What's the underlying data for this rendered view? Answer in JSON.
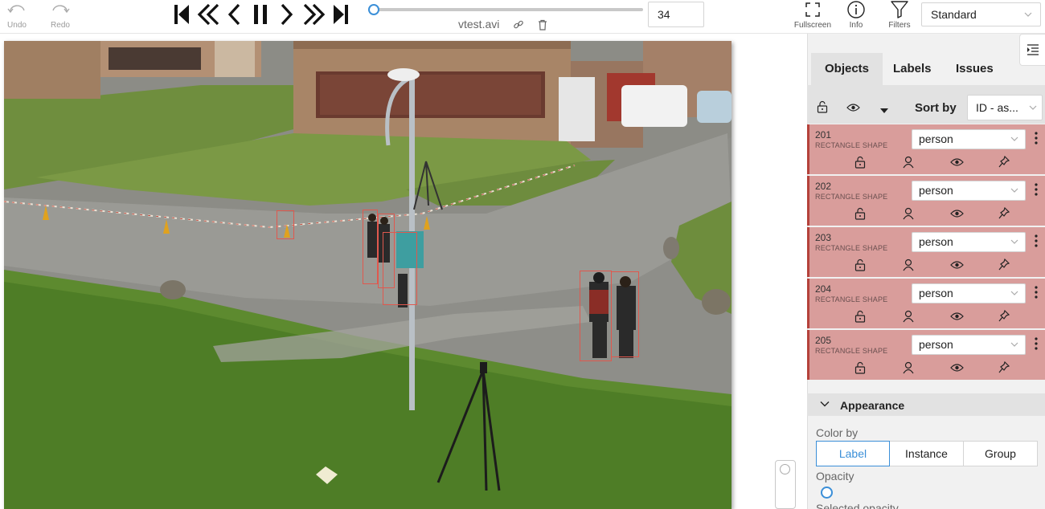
{
  "toolbar": {
    "undo_label": "Undo",
    "redo_label": "Redo",
    "player_icons": [
      "first-frame-icon",
      "back-many-icon",
      "previous-icon",
      "pause-icon",
      "next-icon",
      "forward-many-icon",
      "last-frame-icon"
    ],
    "frame_progress": 0.02,
    "frame_number": "34",
    "filename": "vtest.avi",
    "fullscreen_label": "Fullscreen",
    "info_label": "Info",
    "filters_label": "Filters",
    "workspace_value": "Standard"
  },
  "panel": {
    "tabs": [
      {
        "label": "Objects"
      },
      {
        "label": "Labels"
      },
      {
        "label": "Issues"
      }
    ],
    "sort_label": "Sort by",
    "sort_value": "ID - as...",
    "objects": [
      {
        "id": "201",
        "type": "RECTANGLE SHAPE",
        "label": "person"
      },
      {
        "id": "202",
        "type": "RECTANGLE SHAPE",
        "label": "person"
      },
      {
        "id": "203",
        "type": "RECTANGLE SHAPE",
        "label": "person"
      },
      {
        "id": "204",
        "type": "RECTANGLE SHAPE",
        "label": "person"
      },
      {
        "id": "205",
        "type": "RECTANGLE SHAPE",
        "label": "person"
      }
    ],
    "appearance": {
      "title": "Appearance",
      "color_by_label": "Color by",
      "color_by_options": [
        "Label",
        "Instance",
        "Group"
      ],
      "color_by_selected": "Label",
      "opacity_label": "Opacity",
      "opacity_value": 0,
      "selected_opacity_label": "Selected opacity"
    }
  },
  "colors": {
    "accent": "#3b8fd8",
    "object_row": "#d99d9b",
    "object_border": "#b5423b",
    "bbox": "#e0584e"
  }
}
